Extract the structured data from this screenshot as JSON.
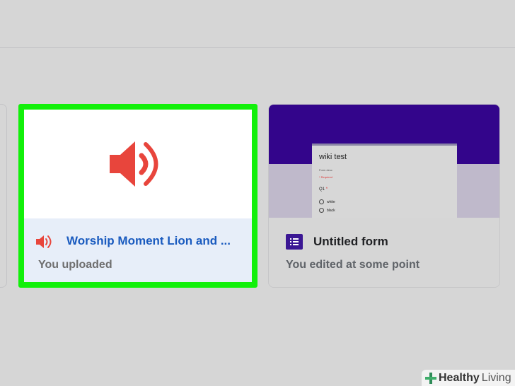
{
  "cards": [
    {
      "type": "audio",
      "title": "Worship Moment Lion and ...",
      "subtitle": "You uploaded",
      "icon": "speaker-icon",
      "highlight_color": "#12f00a",
      "icon_color": "#e8453c"
    },
    {
      "type": "form",
      "title": "Untitled form",
      "subtitle": "You edited at some point",
      "icon": "forms-icon",
      "accent_color": "#33058b",
      "preview": {
        "title": "wiki test",
        "description": "Form desc",
        "required": "* Required",
        "question": "Q1",
        "required_star": "*",
        "options": [
          "white",
          "black"
        ]
      }
    }
  ],
  "watermark": {
    "healthy": "Healthy",
    "living": "Living"
  }
}
